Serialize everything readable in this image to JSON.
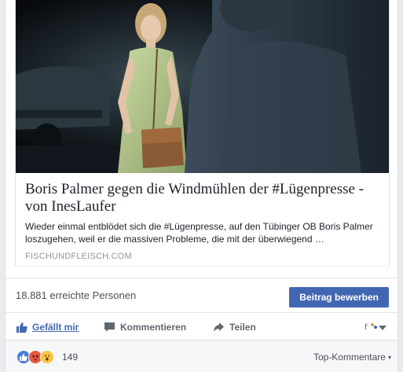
{
  "link_preview": {
    "title": "Boris Palmer gegen die Windmühlen der #Lügenpresse - von InesLaufer",
    "description": "Wieder einmal entblödet sich die #Lügenpresse, auf den Tübinger OB Boris Palmer loszugehen, weil er die massiven Probleme, die mit der überwiegend …",
    "domain": "FISCHUNDFLEISCH.COM"
  },
  "reach": {
    "text": "18.881 erreichte Personen",
    "boost_label": "Beitrag bewerben"
  },
  "actions": {
    "like_label": "Gefällt mir",
    "comment_label": "Kommentieren",
    "share_label": "Teilen"
  },
  "reactions": {
    "count": "149",
    "types": [
      "like-icon",
      "angry-icon",
      "wow-icon"
    ],
    "sort_label": "Top-Kommentare"
  },
  "colors": {
    "accent": "#4267b2",
    "text": "#1d2129",
    "muted": "#90949c",
    "footer_bg": "#f6f7f9"
  }
}
